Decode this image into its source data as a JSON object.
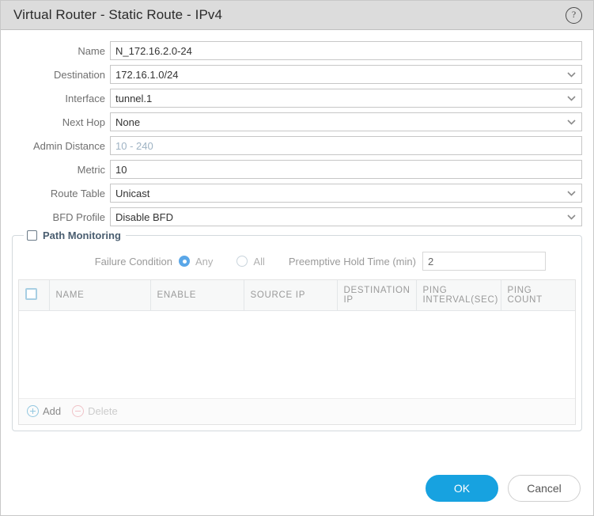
{
  "window": {
    "title": "Virtual Router - Static Route - IPv4",
    "help_icon": "help-circle-icon",
    "help_glyph": "?"
  },
  "form": {
    "fields": [
      {
        "label": "Name",
        "value": "N_172.16.2.0-24",
        "type": "text",
        "placeholder": ""
      },
      {
        "label": "Destination",
        "value": "172.16.1.0/24",
        "type": "select",
        "placeholder": ""
      },
      {
        "label": "Interface",
        "value": "tunnel.1",
        "type": "select",
        "placeholder": ""
      },
      {
        "label": "Next Hop",
        "value": "None",
        "type": "select",
        "placeholder": ""
      },
      {
        "label": "Admin Distance",
        "value": "",
        "type": "text",
        "placeholder": "10 - 240"
      },
      {
        "label": "Metric",
        "value": "10",
        "type": "text",
        "placeholder": ""
      },
      {
        "label": "Route Table",
        "value": "Unicast",
        "type": "select",
        "placeholder": ""
      },
      {
        "label": "BFD Profile",
        "value": "Disable BFD",
        "type": "select",
        "placeholder": ""
      }
    ]
  },
  "path_monitoring": {
    "legend": "Path Monitoring",
    "checked": false,
    "failure_condition": {
      "label": "Failure Condition",
      "options": [
        {
          "label": "Any",
          "selected": true
        },
        {
          "label": "All",
          "selected": false
        }
      ]
    },
    "preemptive_hold_time": {
      "label": "Preemptive Hold Time (min)",
      "value": "2"
    },
    "table": {
      "columns": [
        "NAME",
        "ENABLE",
        "SOURCE IP",
        "DESTINATION IP",
        "PING INTERVAL(SEC)",
        "PING COUNT"
      ],
      "rows": [],
      "select_all_checked": false,
      "toolbar": {
        "add_label": "Add",
        "delete_label": "Delete",
        "delete_disabled": true
      }
    }
  },
  "footer": {
    "ok_label": "OK",
    "cancel_label": "Cancel"
  },
  "colors": {
    "accent": "#17a2e0",
    "titlebar": "#dcdcdc",
    "radio_on": "#5aa7e8"
  }
}
